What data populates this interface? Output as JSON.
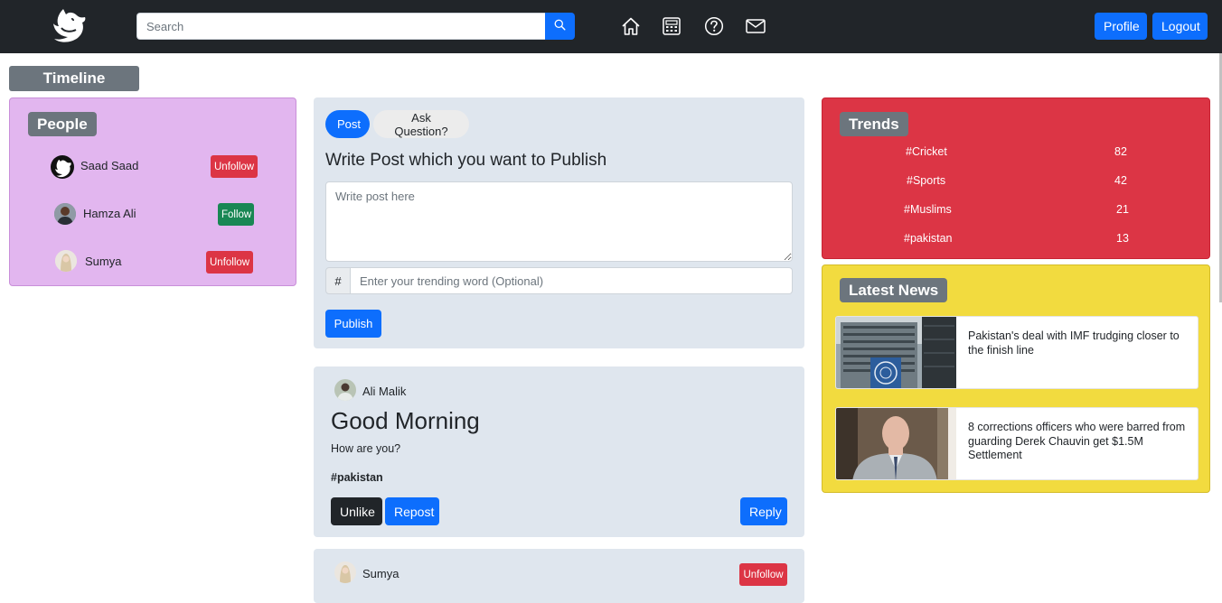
{
  "navbar": {
    "search_placeholder": "Search",
    "profile_label": "Profile",
    "logout_label": "Logout"
  },
  "timeline": {
    "label": "Timeline"
  },
  "people": {
    "title": "People",
    "items": [
      {
        "name": "Saad Saad",
        "action": "Unfollow"
      },
      {
        "name": "Hamza Ali",
        "action": "Follow"
      },
      {
        "name": "Sumya",
        "action": "Unfollow"
      }
    ]
  },
  "composer": {
    "tab_post": "Post",
    "tab_question": "Ask Question?",
    "heading": "Write Post which you want to Publish",
    "textarea_placeholder": "Write post here",
    "hash_prefix": "#",
    "hash_placeholder": "Enter your trending word (Optional)",
    "publish_label": "Publish"
  },
  "posts": [
    {
      "author": "Ali Malik",
      "title": "Good Morning",
      "body": "How are you?",
      "tag": "#pakistan",
      "unlike_label": "Unlike",
      "repost_label": "Repost",
      "reply_label": "Reply"
    },
    {
      "author": "Sumya",
      "unfollow_label": "Unfollow"
    }
  ],
  "trends": {
    "title": "Trends",
    "items": [
      {
        "tag": "#Cricket",
        "count": "82"
      },
      {
        "tag": "#Sports",
        "count": "42"
      },
      {
        "tag": "#Muslims",
        "count": "21"
      },
      {
        "tag": "#pakistan",
        "count": "13"
      }
    ]
  },
  "news": {
    "title": "Latest News",
    "items": [
      {
        "headline": "Pakistan's deal with IMF trudging closer to the finish line"
      },
      {
        "headline": "8 corrections officers who were barred from guarding Derek Chauvin get $1.5M Settlement"
      }
    ]
  },
  "colors": {
    "navbar": "#212529",
    "primary": "#0d6efd",
    "danger": "#dc3545",
    "success": "#198754",
    "people_bg": "#e2b6ef",
    "news_bg": "#f2db3f",
    "card_bg": "#dfe6ee"
  }
}
